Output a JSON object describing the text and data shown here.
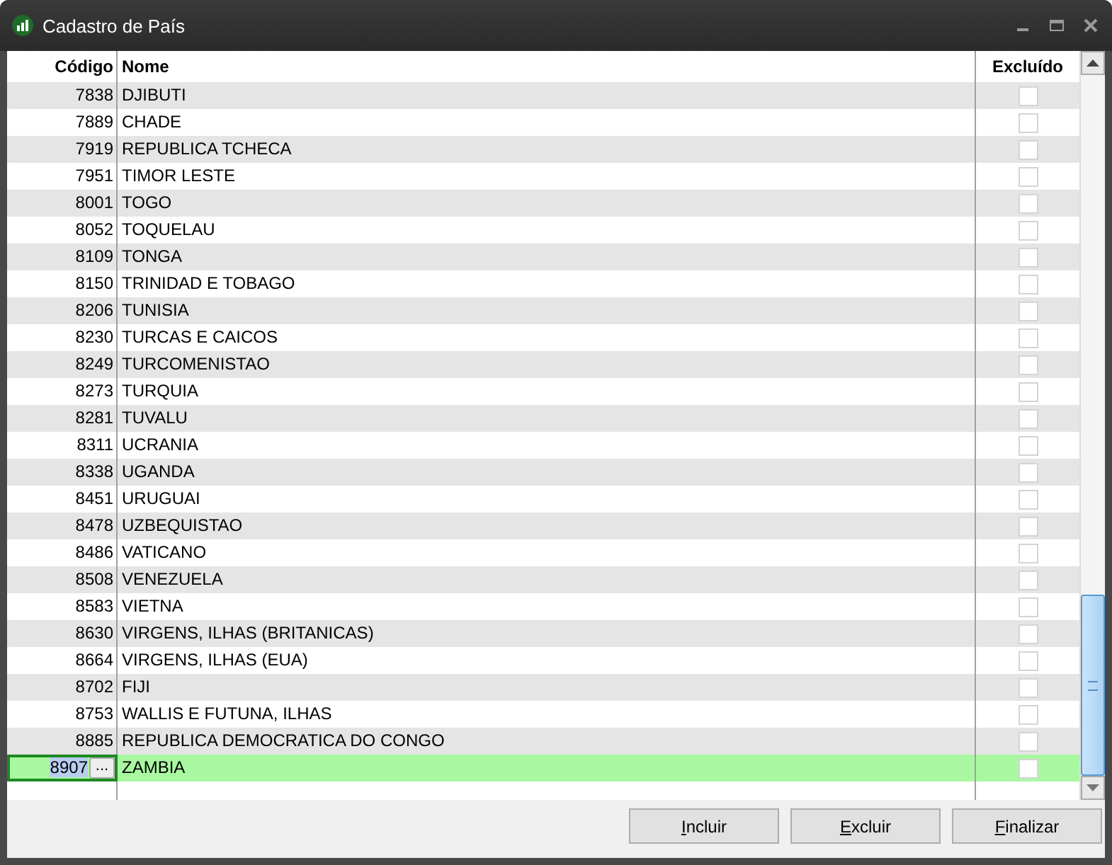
{
  "window": {
    "title": "Cadastro de País"
  },
  "table": {
    "columns": [
      "Código",
      "Nome",
      "Excluído"
    ],
    "rows": [
      {
        "code": "7838",
        "name": "DJIBUTI",
        "excluded": false,
        "selected": false
      },
      {
        "code": "7889",
        "name": "CHADE",
        "excluded": false,
        "selected": false
      },
      {
        "code": "7919",
        "name": "REPUBLICA TCHECA",
        "excluded": false,
        "selected": false
      },
      {
        "code": "7951",
        "name": "TIMOR LESTE",
        "excluded": false,
        "selected": false
      },
      {
        "code": "8001",
        "name": "TOGO",
        "excluded": false,
        "selected": false
      },
      {
        "code": "8052",
        "name": "TOQUELAU",
        "excluded": false,
        "selected": false
      },
      {
        "code": "8109",
        "name": "TONGA",
        "excluded": false,
        "selected": false
      },
      {
        "code": "8150",
        "name": "TRINIDAD E TOBAGO",
        "excluded": false,
        "selected": false
      },
      {
        "code": "8206",
        "name": "TUNISIA",
        "excluded": false,
        "selected": false
      },
      {
        "code": "8230",
        "name": "TURCAS E CAICOS",
        "excluded": false,
        "selected": false
      },
      {
        "code": "8249",
        "name": "TURCOMENISTAO",
        "excluded": false,
        "selected": false
      },
      {
        "code": "8273",
        "name": "TURQUIA",
        "excluded": false,
        "selected": false
      },
      {
        "code": "8281",
        "name": "TUVALU",
        "excluded": false,
        "selected": false
      },
      {
        "code": "8311",
        "name": "UCRANIA",
        "excluded": false,
        "selected": false
      },
      {
        "code": "8338",
        "name": "UGANDA",
        "excluded": false,
        "selected": false
      },
      {
        "code": "8451",
        "name": "URUGUAI",
        "excluded": false,
        "selected": false
      },
      {
        "code": "8478",
        "name": "UZBEQUISTAO",
        "excluded": false,
        "selected": false
      },
      {
        "code": "8486",
        "name": "VATICANO",
        "excluded": false,
        "selected": false
      },
      {
        "code": "8508",
        "name": "VENEZUELA",
        "excluded": false,
        "selected": false
      },
      {
        "code": "8583",
        "name": "VIETNA",
        "excluded": false,
        "selected": false
      },
      {
        "code": "8630",
        "name": "VIRGENS, ILHAS (BRITANICAS)",
        "excluded": false,
        "selected": false
      },
      {
        "code": "8664",
        "name": "VIRGENS, ILHAS (EUA)",
        "excluded": false,
        "selected": false
      },
      {
        "code": "8702",
        "name": "FIJI",
        "excluded": false,
        "selected": false
      },
      {
        "code": "8753",
        "name": "WALLIS E FUTUNA, ILHAS",
        "excluded": false,
        "selected": false
      },
      {
        "code": "8885",
        "name": "REPUBLICA DEMOCRATICA DO CONGO",
        "excluded": false,
        "selected": false
      },
      {
        "code": "8907",
        "name": "ZAMBIA",
        "excluded": false,
        "selected": true,
        "lookup_button": "..."
      }
    ]
  },
  "buttons": [
    "Incluir",
    "Excluir",
    "Finalizar"
  ]
}
